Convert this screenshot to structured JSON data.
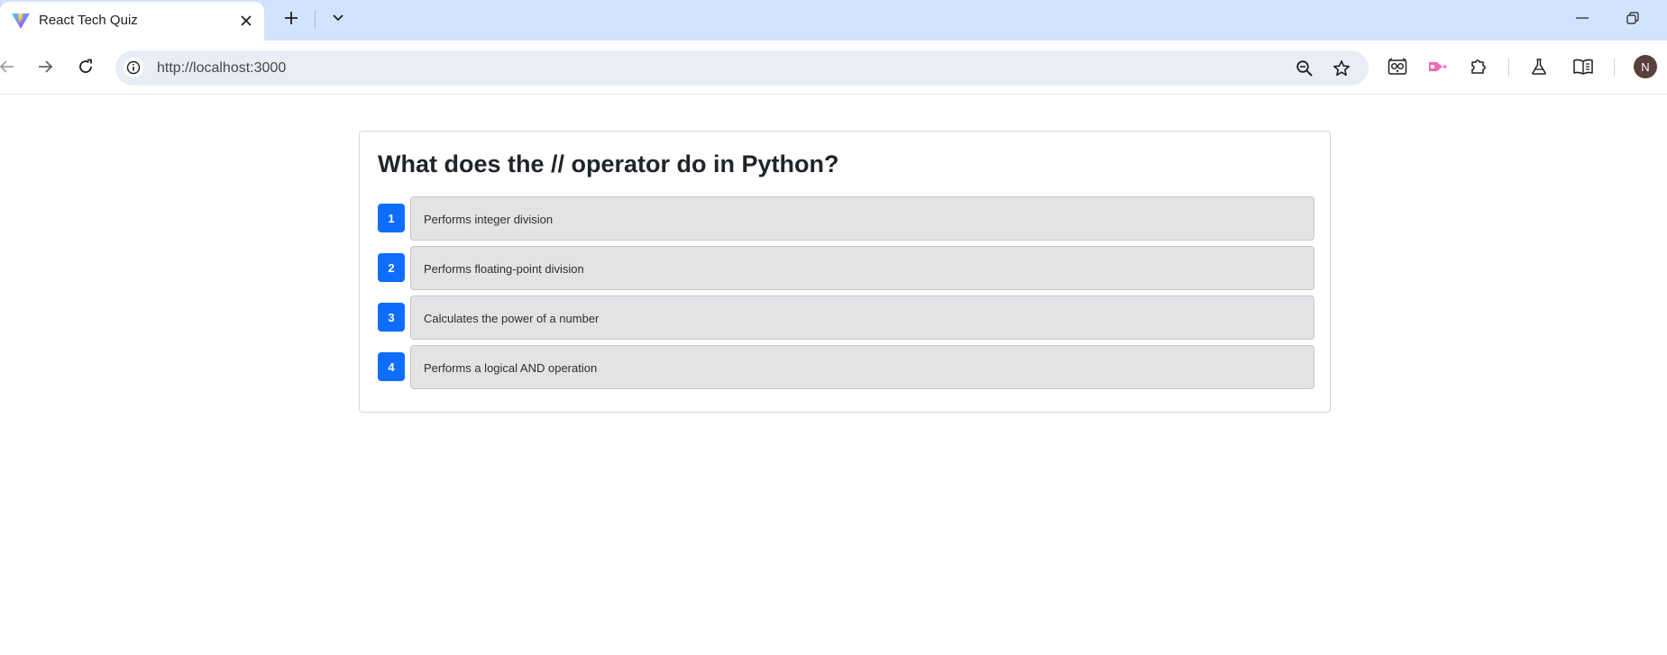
{
  "browser": {
    "tab": {
      "title": "React Tech Quiz",
      "favicon": "vite-icon",
      "close_icon": "close-icon"
    },
    "new_tab_icon": "plus-icon",
    "tab_search_icon": "chevron-down-icon",
    "window_controls": [
      "minimize-icon",
      "restore-icon"
    ],
    "toolbar": {
      "back_icon": "back-arrow-icon",
      "forward_icon": "forward-arrow-icon",
      "reload_icon": "reload-icon",
      "url": "http://localhost:3000",
      "site_info_icon": "info-icon",
      "zoom_icon": "zoom-out-icon",
      "bookmark_icon": "star-icon",
      "extensions": [
        "owl-extension-icon",
        "pink-arrow-extension-icon",
        "puzzle-icon",
        "flask-icon",
        "reading-list-icon"
      ],
      "profile_initial": "N"
    },
    "colors": {
      "tabstrip": "#d3e3fd",
      "omnibox": "#e9eef6",
      "avatar": "#5b3f3a"
    }
  },
  "quiz": {
    "question": "What does the // operator do in Python?",
    "answers": [
      {
        "number": "1",
        "text": "Performs integer division"
      },
      {
        "number": "2",
        "text": "Performs floating-point division"
      },
      {
        "number": "3",
        "text": "Calculates the power of a number"
      },
      {
        "number": "4",
        "text": "Performs a logical AND operation"
      }
    ],
    "colors": {
      "number_badge": "#0d6efd",
      "answer_background": "#e2e3e5"
    }
  }
}
